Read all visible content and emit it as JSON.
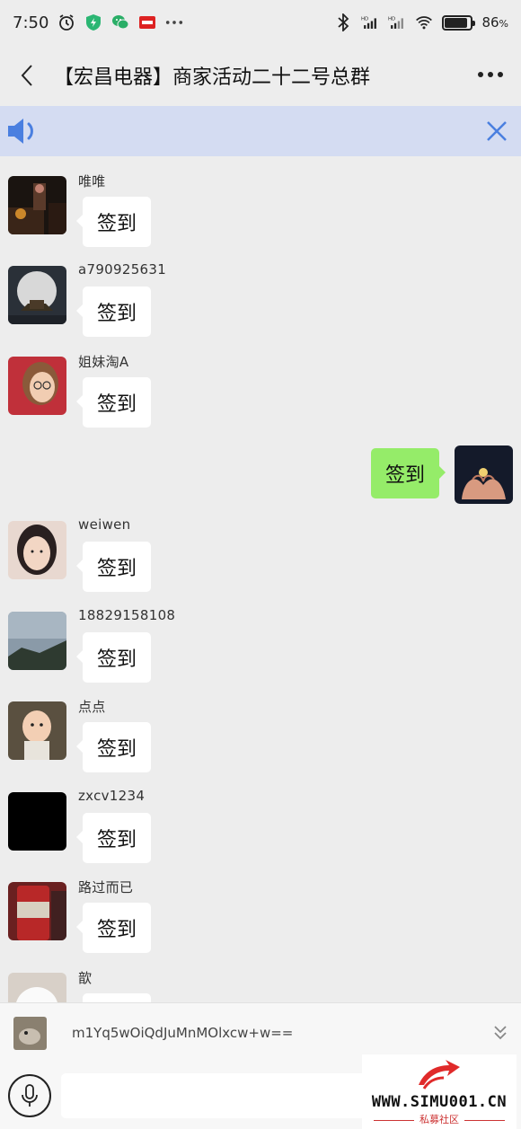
{
  "status_bar": {
    "time": "7:50",
    "battery_level": 0.86,
    "battery_text": "86",
    "battery_unit": "%",
    "icons": [
      "alarm-icon",
      "shield-icon",
      "wechat-icon",
      "app-badge-icon",
      "more-dots-icon",
      "bluetooth-icon",
      "signal-hd-icon",
      "signal-hd-icon",
      "wifi-icon",
      "battery-icon"
    ]
  },
  "header": {
    "title": "【宏昌电器】商家活动二十二号总群",
    "back_icon": "chevron-left-icon",
    "more_icon": "more-horizontal-icon"
  },
  "notice": {
    "speaker_icon": "speaker-icon",
    "close_icon": "close-icon",
    "accent_color": "#4a7fe0"
  },
  "messages": [
    {
      "sender": "唯唯",
      "text": "签到",
      "avatar": "avatar-candle-scene"
    },
    {
      "sender": "a790925631",
      "text": "签到",
      "avatar": "avatar-moon-pavilion"
    },
    {
      "sender": "姐妹淘A",
      "text": "签到",
      "avatar": "avatar-girl-glasses"
    },
    {
      "sender": "weiwen",
      "text": "签到",
      "avatar": "avatar-girl-portrait"
    },
    {
      "sender": "18829158108",
      "text": "签到",
      "avatar": "avatar-cloudy-sky"
    },
    {
      "sender": "点点",
      "text": "签到",
      "avatar": "avatar-baby"
    },
    {
      "sender": "zxcv1234",
      "text": "签到",
      "avatar": "avatar-black"
    },
    {
      "sender": "路过而已",
      "text": "签到",
      "avatar": "avatar-red-can"
    },
    {
      "sender": "歆",
      "text": "",
      "avatar": "avatar-cartoon-bear"
    }
  ],
  "self_message": {
    "text": "签到",
    "avatar": "avatar-heart-hands"
  },
  "quote": {
    "text": "m1Yq5wOiQdJuMnMOlxcw+w==",
    "chevron_icon": "double-chevron-down-icon"
  },
  "input_bar": {
    "voice_icon": "microphone-icon",
    "input_value": ""
  },
  "watermark": {
    "url": "WWW.SIMU001.CN",
    "subtitle": "私募社区"
  },
  "colors": {
    "background": "#ededed",
    "notice_bg": "#d4dcf2",
    "self_bubble": "#95ec69",
    "other_bubble": "#ffffff"
  }
}
